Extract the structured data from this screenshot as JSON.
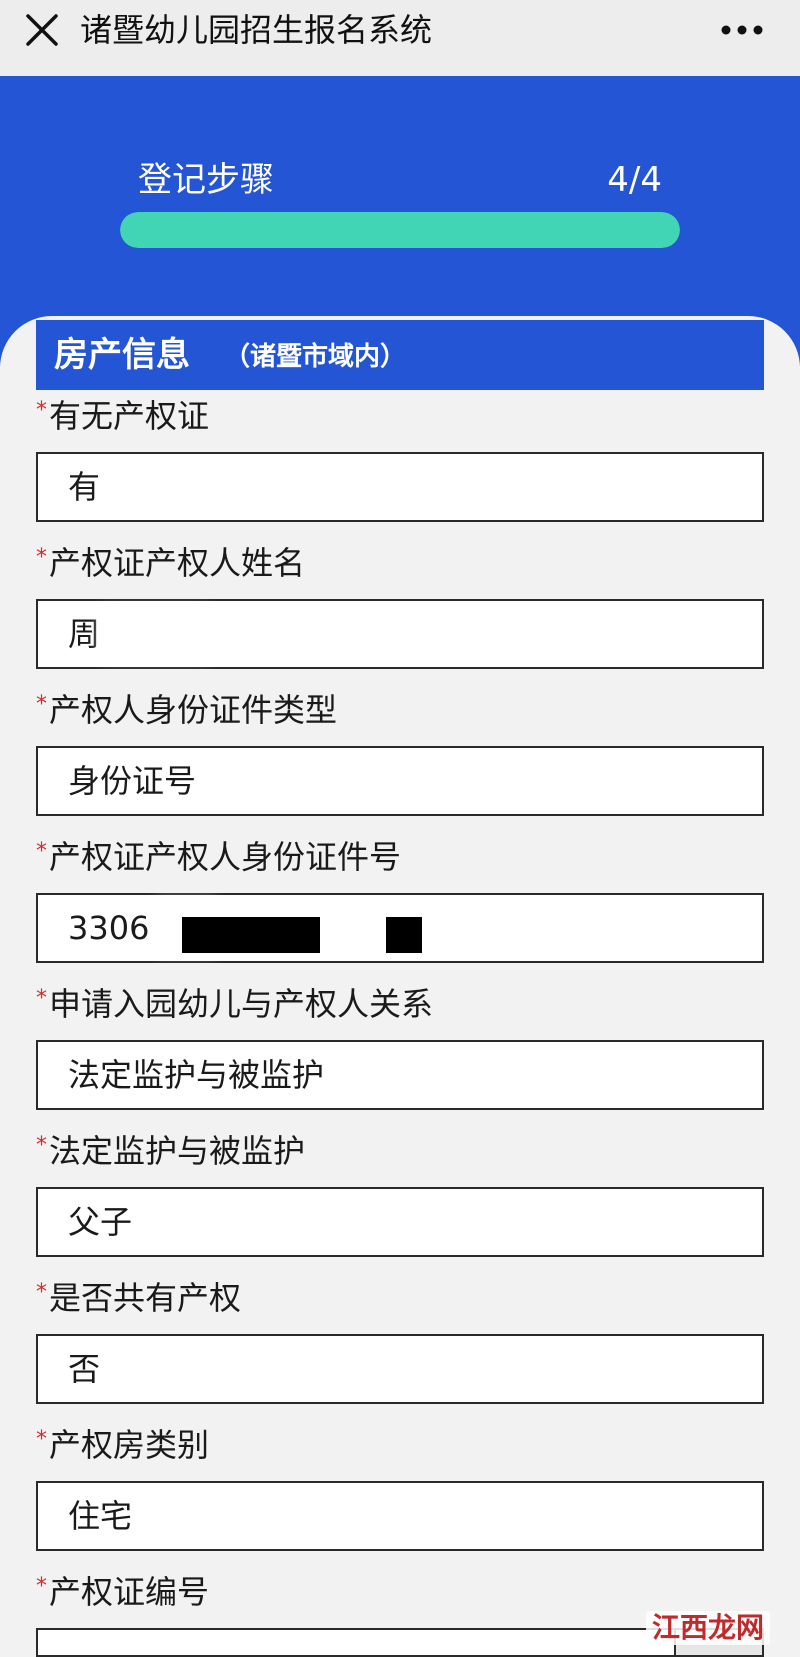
{
  "header": {
    "title": "诸暨幼儿园招生报名系统",
    "close_icon": "close-icon",
    "more_icon": "more-icon"
  },
  "progress": {
    "label": "登记步骤",
    "count_text": "4/4",
    "current": 4,
    "total": 4,
    "fill_fraction": 1.0,
    "fill_color": "#41d5b5"
  },
  "section": {
    "title": "房产信息",
    "subtitle": "（诸暨市域内）",
    "color": "#2455d4"
  },
  "fields": [
    {
      "label": "有无产权证",
      "value": "有",
      "required": "*"
    },
    {
      "label": "产权证产权人姓名",
      "value": "周",
      "required": "*"
    },
    {
      "label": "产权人身份证件类型",
      "value": "身份证号",
      "required": "*"
    },
    {
      "label": "产权证产权人身份证件号",
      "value": "3306",
      "required": "*"
    },
    {
      "label": "申请入园幼儿与产权人关系",
      "value": "法定监护与被监护",
      "required": "*"
    },
    {
      "label": "法定监护与被监护",
      "value": "父子",
      "required": "*"
    },
    {
      "label": "是否共有产权",
      "value": "否",
      "required": "*"
    },
    {
      "label": "产权房类别",
      "value": "住宅",
      "required": "*"
    },
    {
      "label": "产权证编号",
      "value": "",
      "required": "*"
    }
  ],
  "watermark": {
    "text": "江西龙网"
  }
}
